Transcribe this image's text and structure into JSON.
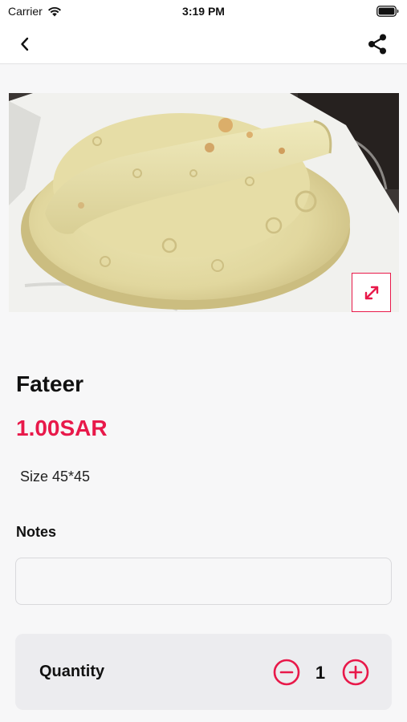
{
  "status_bar": {
    "carrier": "Carrier",
    "time": "3:19 PM"
  },
  "nav": {
    "back_icon": "chevron-left-icon",
    "share_icon": "share-icon"
  },
  "product": {
    "image_alt": "Fateer",
    "title": "Fateer",
    "price": "1.00SAR",
    "size": "Size 45*45"
  },
  "notes": {
    "label": "Notes",
    "value": "",
    "placeholder": ""
  },
  "quantity": {
    "label": "Quantity",
    "value": "1"
  },
  "colors": {
    "accent": "#e8194a",
    "background": "#f7f7f8",
    "card": "#ececef"
  }
}
